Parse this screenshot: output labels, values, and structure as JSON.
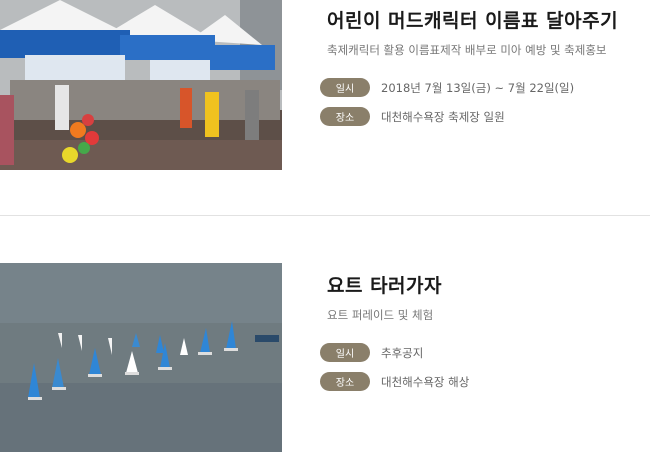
{
  "events": [
    {
      "title": "어린이 머드캐릭터 이름표 달아주기",
      "subtitle": "축제캐릭터 활용 이름표제작 배부로 미아 예방 및 축제홍보",
      "date_label": "일시",
      "date_value": "2018년 7월 13일(금) ~ 7월 22일(일)",
      "place_label": "장소",
      "place_value": "대천해수욕장 축제장 일원",
      "photo": "festival-tent-photo"
    },
    {
      "title": "요트 타러가자",
      "subtitle": "요트 퍼레이드 및 체험",
      "date_label": "일시",
      "date_value": "추후공지",
      "place_label": "장소",
      "place_value": "대천해수욕장 해상",
      "photo": "yacht-sea-photo"
    }
  ],
  "colors": {
    "badge": "#8a7f6a",
    "title": "#1a1a1a",
    "text": "#666666",
    "sea": "#6f7b80"
  }
}
